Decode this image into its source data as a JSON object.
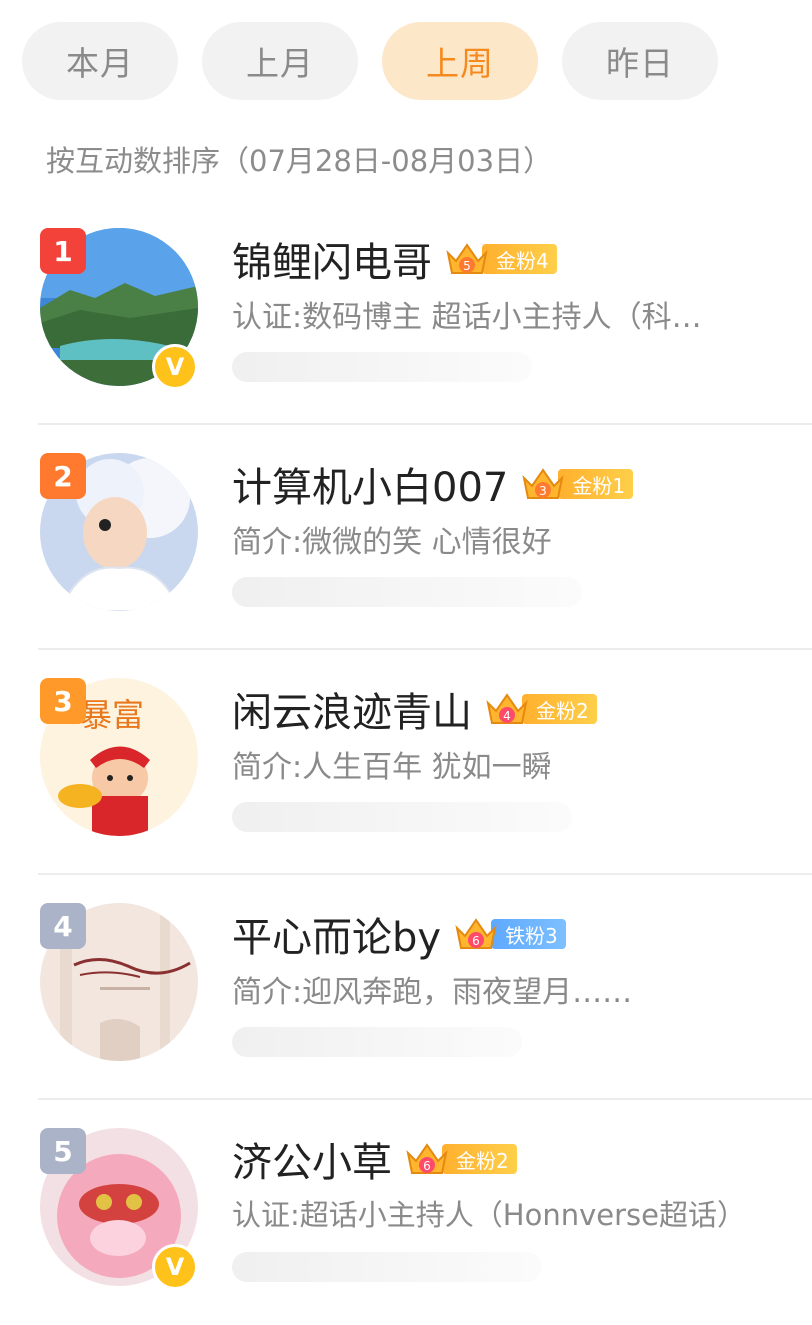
{
  "tabs": [
    {
      "label": "本月",
      "active": false
    },
    {
      "label": "上月",
      "active": false
    },
    {
      "label": "上周",
      "active": true
    },
    {
      "label": "昨日",
      "active": false
    }
  ],
  "sort_note": "按互动数排序（07月28日-08月03日）",
  "colors": {
    "accent": "#f58a1f",
    "gold_fan": "#ffb02e",
    "iron_fan": "#5ea8ff"
  },
  "users": [
    {
      "rank": "1",
      "name": "锦鲤闪电哥",
      "crown_level": "5",
      "fan_label": "金粉4",
      "fan_type": "gold",
      "desc": "认证:数码博主 超话小主持人（科…",
      "verified": true,
      "avatar_icon": "landscape-lake-avatar"
    },
    {
      "rank": "2",
      "name": "计算机小白007",
      "crown_level": "3",
      "fan_label": "金粉1",
      "fan_type": "gold",
      "desc": "简介:微微的笑 心情很好",
      "verified": false,
      "avatar_icon": "anime-character-avatar"
    },
    {
      "rank": "3",
      "name": "闲云浪迹青山",
      "crown_level": "4",
      "fan_label": "金粉2",
      "fan_type": "gold",
      "desc": "简介:人生百年 犹如一瞬",
      "verified": false,
      "avatar_icon": "fortune-god-avatar",
      "avatar_text": "暴富"
    },
    {
      "rank": "4",
      "name": "平心而论by",
      "crown_level": "6",
      "fan_label": "铁粉3",
      "fan_type": "iron",
      "desc": "简介:迎风奔跑，雨夜望月……",
      "verified": false,
      "avatar_icon": "calligraphy-avatar"
    },
    {
      "rank": "5",
      "name": "济公小草",
      "crown_level": "6",
      "fan_label": "金粉2",
      "fan_type": "gold",
      "desc": "认证:超话小主持人（Honnverse超话）",
      "verified": true,
      "avatar_icon": "pink-monkey-avatar"
    }
  ]
}
